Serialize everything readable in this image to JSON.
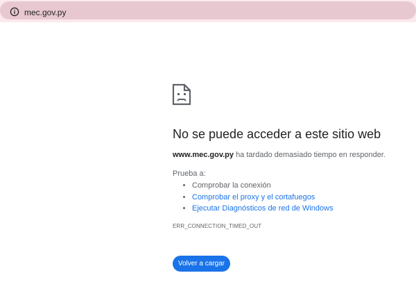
{
  "address_bar": {
    "url": "mec.gov.py",
    "info_icon": "info-icon"
  },
  "error_page": {
    "icon": "sad-page-icon",
    "title": "No se puede acceder a este sitio web",
    "host": "www.mec.gov.py",
    "description": " ha tardado demasiado tiempo en responder.",
    "try_label": "Prueba a:",
    "suggestions": [
      {
        "label": "Comprobar la conexión",
        "link": false
      },
      {
        "label": "Comprobar el proxy y el cortafuegos",
        "link": true
      },
      {
        "label": "Ejecutar Diagnósticos de red de Windows",
        "link": true
      }
    ],
    "error_code": "ERR_CONNECTION_TIMED_OUT",
    "reload_button": "Volver a cargar"
  },
  "colors": {
    "accent": "#1a73e8",
    "address_bar_bg": "#e8c8d0",
    "top_strip_bg": "#fbe9ee"
  }
}
